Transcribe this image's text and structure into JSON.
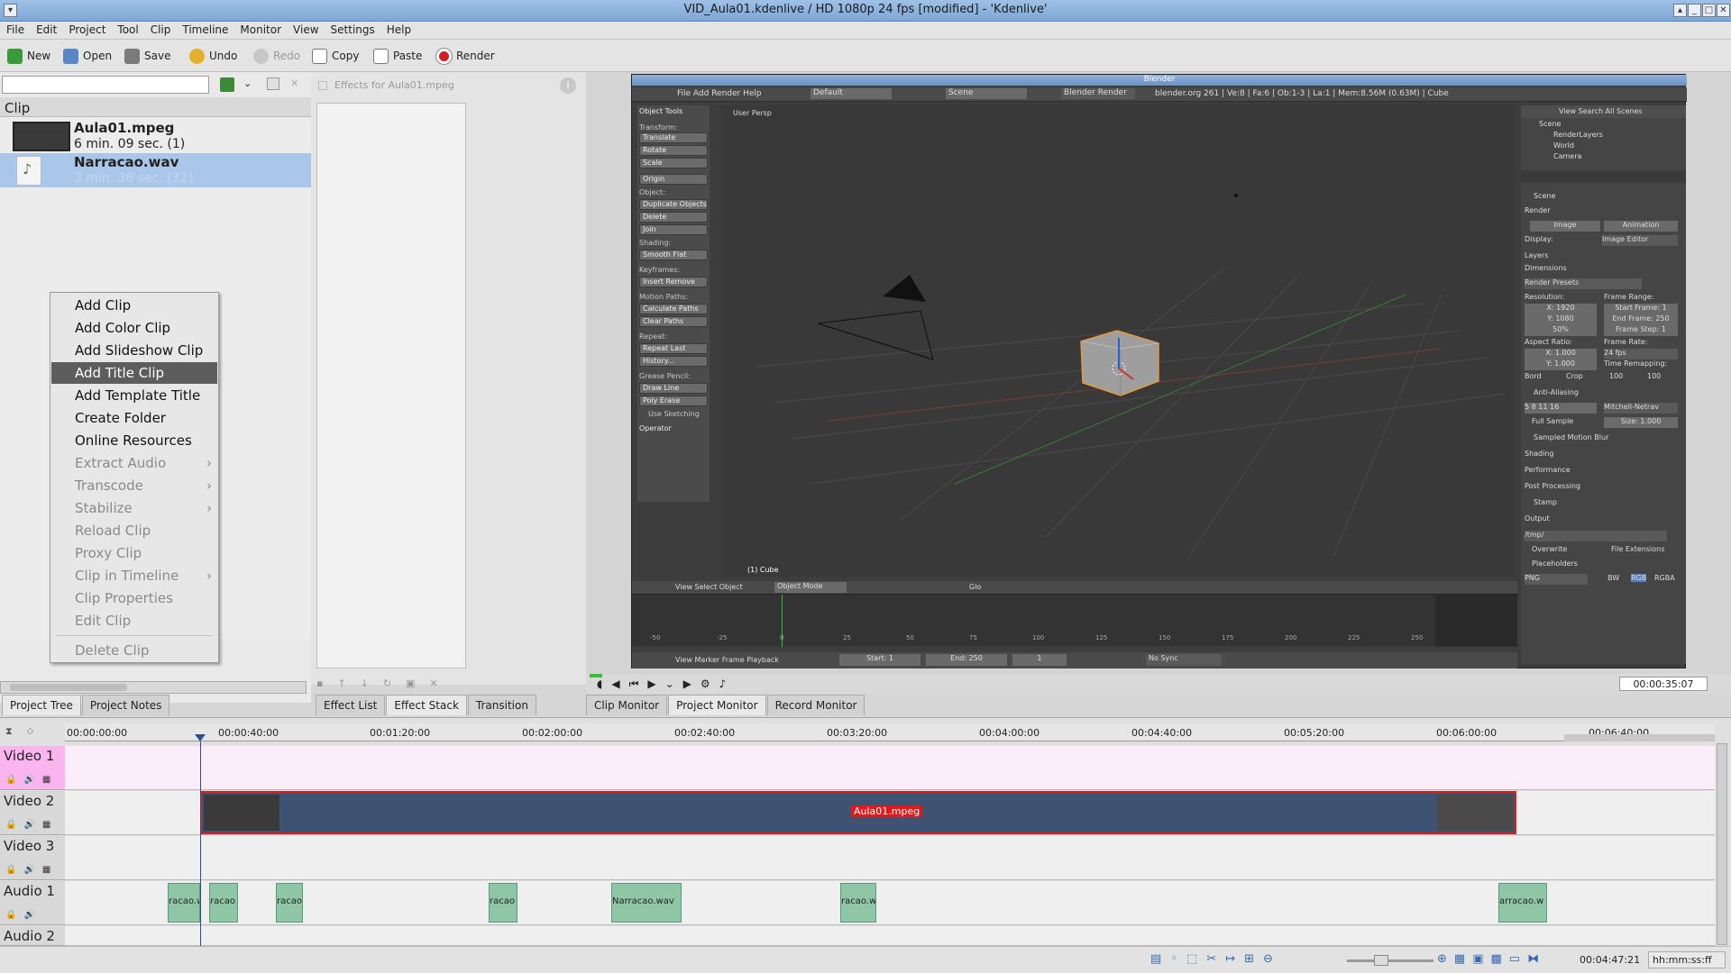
{
  "window": {
    "title": "VID_Aula01.kdenlive / HD 1080p 24 fps [modified] - 'Kdenlive'"
  },
  "menubar": [
    "File",
    "Edit",
    "Project",
    "Tool",
    "Clip",
    "Timeline",
    "Monitor",
    "View",
    "Settings",
    "Help"
  ],
  "toolbar": {
    "new": "New",
    "open": "Open",
    "save": "Save",
    "undo": "Undo",
    "redo": "Redo",
    "copy": "Copy",
    "paste": "Paste",
    "render": "Render"
  },
  "project_bin": {
    "header": "Clip",
    "clips": [
      {
        "name": "Aula01.mpeg",
        "duration": "6 min. 09 sec. (1)"
      },
      {
        "name": "Narracao.wav",
        "duration": "3 min. 36 sec. (32)"
      }
    ]
  },
  "context_menu": {
    "items": [
      {
        "label": "Add Clip",
        "enabled": true
      },
      {
        "label": "Add Color Clip",
        "enabled": true
      },
      {
        "label": "Add Slideshow Clip",
        "enabled": true
      },
      {
        "label": "Add Title Clip",
        "enabled": true,
        "selected": true
      },
      {
        "label": "Add Template Title",
        "enabled": true
      },
      {
        "label": "Create Folder",
        "enabled": true
      },
      {
        "label": "Online Resources",
        "enabled": true
      },
      {
        "label": "Extract Audio",
        "enabled": false,
        "submenu": true
      },
      {
        "label": "Transcode",
        "enabled": false,
        "submenu": true
      },
      {
        "label": "Stabilize",
        "enabled": false,
        "submenu": true
      },
      {
        "label": "Reload Clip",
        "enabled": false
      },
      {
        "label": "Proxy Clip",
        "enabled": false
      },
      {
        "label": "Clip in Timeline",
        "enabled": false,
        "submenu": true
      },
      {
        "label": "Clip Properties",
        "enabled": false
      },
      {
        "label": "Edit Clip",
        "enabled": false
      },
      {
        "label": "Delete Clip",
        "enabled": false
      }
    ]
  },
  "effects": {
    "header": "Effects for Aula01.mpeg"
  },
  "blender": {
    "title": "Blender",
    "header_menus": "File   Add   Render   Help",
    "layout": "Default",
    "scene": "Scene",
    "engine": "Blender Render",
    "info": "blender.org 261 | Ve:8 | Fa:6 | Ob:1-3 | La:1 | Mem:8.56M (0.63M) | Cube",
    "viewport_label": "User Persp",
    "object_label": "(1) Cube",
    "tools": {
      "title": "Object Tools",
      "transform": "Transform:",
      "translate": "Translate",
      "rotate": "Rotate",
      "scale": "Scale",
      "origin": "Origin",
      "object": "Object:",
      "duplicate": "Duplicate Objects",
      "delete": "Delete",
      "join": "Join",
      "shading": "Shading:",
      "smooth": "Smooth  Flat",
      "keyframes": "Keyframes:",
      "insert": "Insert    Remove",
      "motion": "Motion Paths:",
      "calc": "Calculate Paths",
      "clear": "Clear Paths",
      "repeat": "Repeat:",
      "repeat_last": "Repeat Last",
      "history": "History...",
      "grease": "Grease Pencil:",
      "draw": "Draw      Line",
      "poly": "Poly      Erase",
      "sketch": "Use Sketching",
      "operator": "Operator"
    },
    "outliner": {
      "menus": "View   Search   All Scenes",
      "scene": "Scene",
      "layers": "RenderLayers",
      "world": "World",
      "camera": "Camera"
    },
    "props": {
      "scene": "Scene",
      "render": "Render",
      "image": "Image",
      "animation": "Animation",
      "display": "Display:",
      "display_val": "Image Editor",
      "layers": "Layers",
      "dimensions": "Dimensions",
      "presets": "Render Presets",
      "resolution": "Resolution:",
      "frame_range": "Frame Range:",
      "x": "X: 1920",
      "y": "Y: 1080",
      "pct": "50%",
      "start": "Start Frame: 1",
      "end": "End Frame: 250",
      "step": "Frame Step: 1",
      "aspect": "Aspect Ratio:",
      "frame_rate": "Frame Rate:",
      "ax": "X: 1.000",
      "ay": "Y: 1.000",
      "fps": "24 fps",
      "remap": "Time Remapping:",
      "border": "Bord",
      "crop": "Crop",
      "old": "100",
      "new": "100",
      "aa": "Anti-Aliasing",
      "aa_vals": "5   8   11   16",
      "filter": "Mitchell-Netrav",
      "full": "Full Sample",
      "size": "Size: 1.000",
      "smb": "Sampled Motion Blur",
      "shading": "Shading",
      "perf": "Performance",
      "post": "Post Processing",
      "stamp": "Stamp",
      "output": "Output",
      "path": "/tmp/",
      "overwrite": "Overwrite",
      "ext": "File Extensions",
      "placeholders": "Placeholders",
      "png": "PNG",
      "bw": "BW",
      "rgb": "RGB",
      "rgba": "RGBA"
    },
    "view_hdr": "View   Select   Object",
    "mode": "Object Mode",
    "orient": "Glo",
    "tl_hdr": "View   Marker   Frame   Playback",
    "tl_start": "Start: 1",
    "tl_end": "End: 250",
    "tl_frame": "1",
    "sync": "No Sync",
    "tl_ticks": [
      "-50",
      "-25",
      "0",
      "25",
      "50",
      "75",
      "100",
      "125",
      "150",
      "175",
      "200",
      "225",
      "250"
    ]
  },
  "monitor": {
    "timecode": "00:00:35:07"
  },
  "bottom_tabs": {
    "left": [
      "Project Tree",
      "Project Notes"
    ],
    "middle": [
      "Effect List",
      "Effect Stack",
      "Transition"
    ],
    "monitors": [
      "Clip Monitor",
      "Project Monitor",
      "Record Monitor"
    ]
  },
  "timeline": {
    "ruler": [
      "00:00:00:00",
      "00:00:40:00",
      "00:01:20:00",
      "00:02:00:00",
      "00:02:40:00",
      "00:03:20:00",
      "00:04:00:00",
      "00:04:40:00",
      "00:05:20:00",
      "00:06:00:00",
      "00:06:40:00"
    ],
    "tracks": [
      "Video 1",
      "Video 2",
      "Video 3",
      "Audio 1",
      "Audio 2"
    ],
    "video_clip": "Aula01.mpeg",
    "audio_labels": [
      "racao.w",
      "racao",
      "racao",
      "racao",
      "Narracao.wav",
      "racao.w",
      "arracao.w"
    ]
  },
  "status": {
    "timecode": "00:04:47:21",
    "format": "hh:mm:ss:ff"
  },
  "colors": {
    "selection": "#aac6e8",
    "menu_highlight": "#5d5d5d",
    "clip_video": "#3e5271",
    "clip_border": "#e0191b",
    "clip_audio": "#8fc7a6",
    "video1_track": "#fbedfa"
  }
}
